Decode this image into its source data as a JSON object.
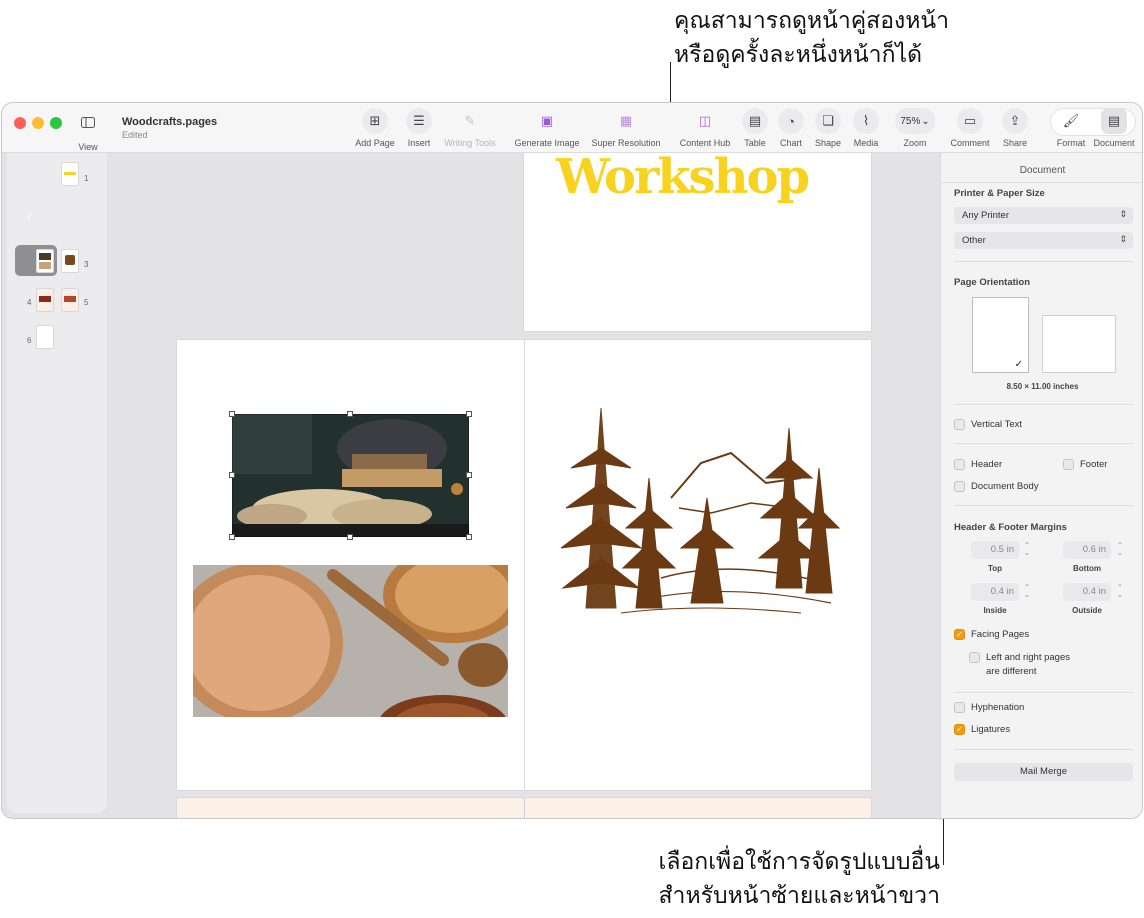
{
  "callouts": {
    "top_line1": "คุณสามารถดูหน้าคู่สองหน้า",
    "top_line2": "หรือดูครั้งละหนึ่งหน้าก็ได้",
    "bottom_line1": "เลือกเพื่อใช้การจัดรูปแบบอื่น",
    "bottom_line2": "สำหรับหน้าซ้ายและหน้าขวา"
  },
  "window": {
    "doc_title": "Woodcrafts.pages",
    "doc_status": "Edited"
  },
  "toolbar": {
    "view": "View",
    "add_page": "Add Page",
    "insert": "Insert",
    "writing_tools": "Writing Tools",
    "generate_image": "Generate Image",
    "super_resolution": "Super Resolution",
    "content_hub": "Content Hub",
    "table": "Table",
    "chart": "Chart",
    "shape": "Shape",
    "media": "Media",
    "zoom_value": "75%",
    "zoom": "Zoom",
    "comment": "Comment",
    "share": "Share",
    "format": "Format",
    "document": "Document"
  },
  "sidebar": {
    "page_numbers": [
      "1",
      "2",
      "3",
      "4",
      "5",
      "6"
    ],
    "selected_page": "2"
  },
  "canvas": {
    "heading": "Workshop"
  },
  "inspector": {
    "header": "Document",
    "printer_section": "Printer & Paper Size",
    "printer_value": "Any Printer",
    "paper_value": "Other",
    "orientation_section": "Page Orientation",
    "paper_size": "8.50 × 11.00 inches",
    "vertical_text": "Vertical Text",
    "header_label": "Header",
    "footer_label": "Footer",
    "document_body": "Document Body",
    "margins_section": "Header & Footer Margins",
    "top_value": "0.5 in",
    "top_label": "Top",
    "bottom_value": "0.6 in",
    "bottom_label": "Bottom",
    "inside_value": "0.4 in",
    "inside_label": "Inside",
    "outside_value": "0.4 in",
    "outside_label": "Outside",
    "facing_pages": "Facing Pages",
    "left_right_line1": "Left and right pages",
    "left_right_line2": "are different",
    "hyphenation": "Hyphenation",
    "ligatures": "Ligatures",
    "mail_merge": "Mail Merge"
  },
  "colors": {
    "accent": "#f29d11",
    "workshop_yellow": "#f7d21e",
    "illustration_brown": "#6b3a12"
  }
}
